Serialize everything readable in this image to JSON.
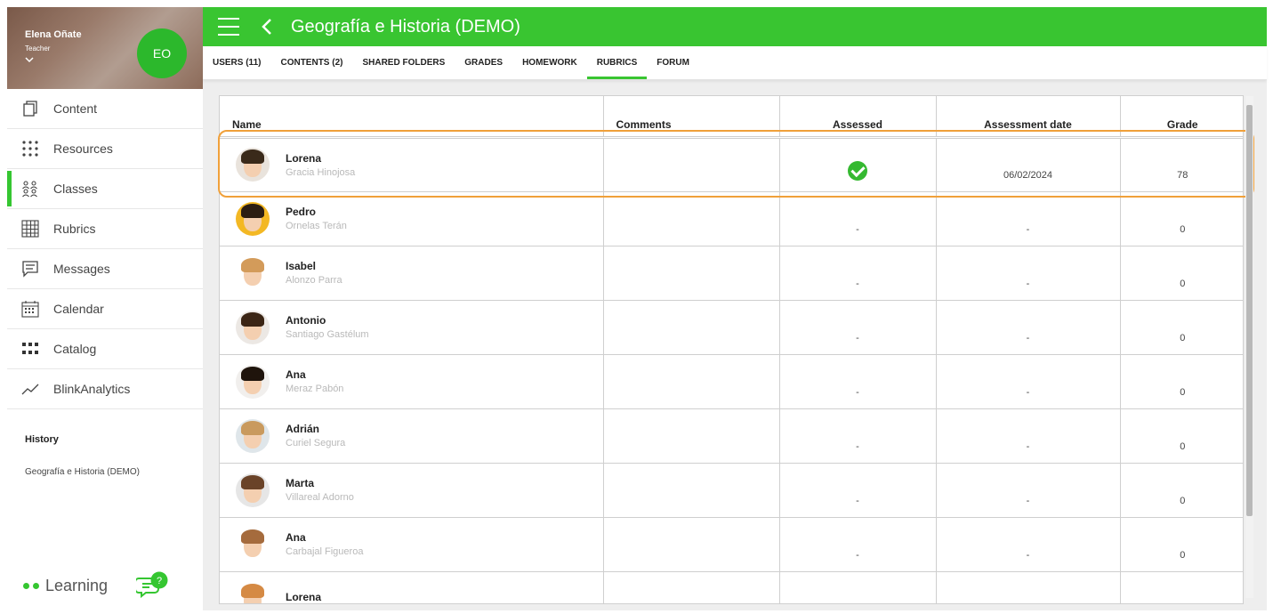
{
  "user": {
    "name": "Elena Oñate",
    "role": "Teacher",
    "initials": "EO",
    "avatar_color": "#19b81c"
  },
  "sidebar": {
    "items": [
      {
        "label": "Content",
        "icon": "content-icon"
      },
      {
        "label": "Resources",
        "icon": "resources-icon"
      },
      {
        "label": "Classes",
        "icon": "classes-icon"
      },
      {
        "label": "Rubrics",
        "icon": "rubrics-icon"
      },
      {
        "label": "Messages",
        "icon": "messages-icon"
      },
      {
        "label": "Calendar",
        "icon": "calendar-icon"
      },
      {
        "label": "Catalog",
        "icon": "catalog-icon"
      },
      {
        "label": "BlinkAnalytics",
        "icon": "analytics-icon"
      }
    ],
    "active_index": 2,
    "history_title": "History",
    "history_item": "Geografía e Historia (DEMO)",
    "brand": "Learning"
  },
  "header": {
    "title": "Geografía e Historia (DEMO)",
    "color": "#39c531"
  },
  "tabs": [
    {
      "label": "USERS (11)"
    },
    {
      "label": "CONTENTS (2)"
    },
    {
      "label": "SHARED FOLDERS"
    },
    {
      "label": "GRADES"
    },
    {
      "label": "HOMEWORK"
    },
    {
      "label": "RUBRICS"
    },
    {
      "label": "FORUM"
    }
  ],
  "active_tab_index": 5,
  "table": {
    "columns": {
      "name": "Name",
      "comments": "Comments",
      "assessed": "Assessed",
      "date": "Assessment date",
      "grade": "Grade"
    },
    "rows": [
      {
        "first": "Lorena",
        "last": "Gracia Hinojosa",
        "comments": "",
        "assessed": true,
        "date": "06/02/2024",
        "grade": "78"
      },
      {
        "first": "Pedro",
        "last": "Ornelas Terán",
        "comments": "",
        "assessed": "-",
        "date": "-",
        "grade": "0"
      },
      {
        "first": "Isabel",
        "last": "Alonzo Parra",
        "comments": "",
        "assessed": "-",
        "date": "-",
        "grade": "0"
      },
      {
        "first": "Antonio",
        "last": "Santiago Gastélum",
        "comments": "",
        "assessed": "-",
        "date": "-",
        "grade": "0"
      },
      {
        "first": "Ana",
        "last": "Meraz Pabón",
        "comments": "",
        "assessed": "-",
        "date": "-",
        "grade": "0"
      },
      {
        "first": "Adrián",
        "last": "Curiel Segura",
        "comments": "",
        "assessed": "-",
        "date": "-",
        "grade": "0"
      },
      {
        "first": "Marta",
        "last": "Villareal Adorno",
        "comments": "",
        "assessed": "-",
        "date": "-",
        "grade": "0"
      },
      {
        "first": "Ana",
        "last": "Carbajal Figueroa",
        "comments": "",
        "assessed": "-",
        "date": "-",
        "grade": "0"
      },
      {
        "first": "Lorena",
        "last": "",
        "comments": "",
        "assessed": "",
        "date": "",
        "grade": ""
      }
    ]
  }
}
